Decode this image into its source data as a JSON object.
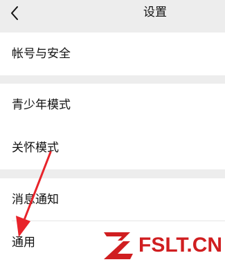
{
  "header": {
    "title": "设置",
    "back_icon": "chevron-left-icon"
  },
  "groups": [
    {
      "items": [
        {
          "label": "帐号与安全"
        }
      ]
    },
    {
      "items": [
        {
          "label": "青少年模式"
        },
        {
          "label": "关怀模式"
        }
      ]
    },
    {
      "items": [
        {
          "label": "消息通知"
        },
        {
          "label": "通用"
        }
      ]
    }
  ],
  "annotation": {
    "arrow_color": "#e8232a",
    "arrow_target": "通用"
  },
  "watermark": {
    "text": "FSLT.CN",
    "color": "#d01e20"
  }
}
